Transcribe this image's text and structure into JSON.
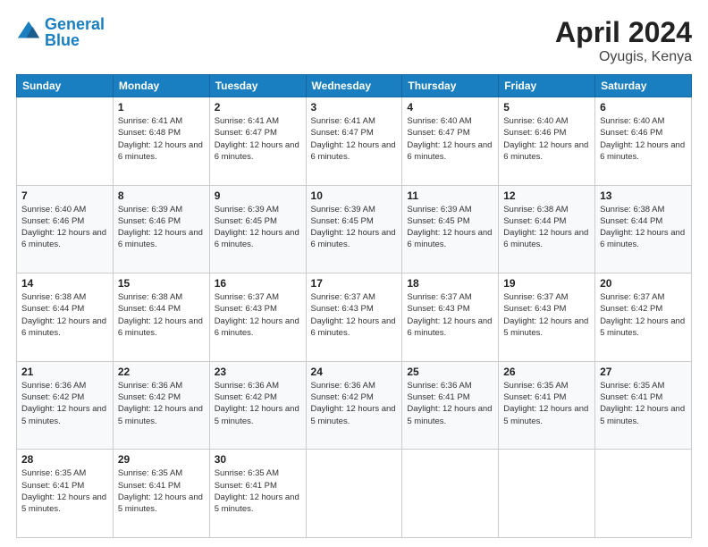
{
  "header": {
    "logo_line1": "General",
    "logo_line2": "Blue",
    "title": "April 2024",
    "subtitle": "Oyugis, Kenya"
  },
  "weekdays": [
    "Sunday",
    "Monday",
    "Tuesday",
    "Wednesday",
    "Thursday",
    "Friday",
    "Saturday"
  ],
  "weeks": [
    [
      {
        "day": "",
        "info": ""
      },
      {
        "day": "1",
        "info": "Sunrise: 6:41 AM\nSunset: 6:48 PM\nDaylight: 12 hours\nand 6 minutes."
      },
      {
        "day": "2",
        "info": "Sunrise: 6:41 AM\nSunset: 6:47 PM\nDaylight: 12 hours\nand 6 minutes."
      },
      {
        "day": "3",
        "info": "Sunrise: 6:41 AM\nSunset: 6:47 PM\nDaylight: 12 hours\nand 6 minutes."
      },
      {
        "day": "4",
        "info": "Sunrise: 6:40 AM\nSunset: 6:47 PM\nDaylight: 12 hours\nand 6 minutes."
      },
      {
        "day": "5",
        "info": "Sunrise: 6:40 AM\nSunset: 6:46 PM\nDaylight: 12 hours\nand 6 minutes."
      },
      {
        "day": "6",
        "info": "Sunrise: 6:40 AM\nSunset: 6:46 PM\nDaylight: 12 hours\nand 6 minutes."
      }
    ],
    [
      {
        "day": "7",
        "info": "Sunrise: 6:40 AM\nSunset: 6:46 PM\nDaylight: 12 hours\nand 6 minutes."
      },
      {
        "day": "8",
        "info": "Sunrise: 6:39 AM\nSunset: 6:46 PM\nDaylight: 12 hours\nand 6 minutes."
      },
      {
        "day": "9",
        "info": "Sunrise: 6:39 AM\nSunset: 6:45 PM\nDaylight: 12 hours\nand 6 minutes."
      },
      {
        "day": "10",
        "info": "Sunrise: 6:39 AM\nSunset: 6:45 PM\nDaylight: 12 hours\nand 6 minutes."
      },
      {
        "day": "11",
        "info": "Sunrise: 6:39 AM\nSunset: 6:45 PM\nDaylight: 12 hours\nand 6 minutes."
      },
      {
        "day": "12",
        "info": "Sunrise: 6:38 AM\nSunset: 6:44 PM\nDaylight: 12 hours\nand 6 minutes."
      },
      {
        "day": "13",
        "info": "Sunrise: 6:38 AM\nSunset: 6:44 PM\nDaylight: 12 hours\nand 6 minutes."
      }
    ],
    [
      {
        "day": "14",
        "info": "Sunrise: 6:38 AM\nSunset: 6:44 PM\nDaylight: 12 hours\nand 6 minutes."
      },
      {
        "day": "15",
        "info": "Sunrise: 6:38 AM\nSunset: 6:44 PM\nDaylight: 12 hours\nand 6 minutes."
      },
      {
        "day": "16",
        "info": "Sunrise: 6:37 AM\nSunset: 6:43 PM\nDaylight: 12 hours\nand 6 minutes."
      },
      {
        "day": "17",
        "info": "Sunrise: 6:37 AM\nSunset: 6:43 PM\nDaylight: 12 hours\nand 6 minutes."
      },
      {
        "day": "18",
        "info": "Sunrise: 6:37 AM\nSunset: 6:43 PM\nDaylight: 12 hours\nand 6 minutes."
      },
      {
        "day": "19",
        "info": "Sunrise: 6:37 AM\nSunset: 6:43 PM\nDaylight: 12 hours\nand 5 minutes."
      },
      {
        "day": "20",
        "info": "Sunrise: 6:37 AM\nSunset: 6:42 PM\nDaylight: 12 hours\nand 5 minutes."
      }
    ],
    [
      {
        "day": "21",
        "info": "Sunrise: 6:36 AM\nSunset: 6:42 PM\nDaylight: 12 hours\nand 5 minutes."
      },
      {
        "day": "22",
        "info": "Sunrise: 6:36 AM\nSunset: 6:42 PM\nDaylight: 12 hours\nand 5 minutes."
      },
      {
        "day": "23",
        "info": "Sunrise: 6:36 AM\nSunset: 6:42 PM\nDaylight: 12 hours\nand 5 minutes."
      },
      {
        "day": "24",
        "info": "Sunrise: 6:36 AM\nSunset: 6:42 PM\nDaylight: 12 hours\nand 5 minutes."
      },
      {
        "day": "25",
        "info": "Sunrise: 6:36 AM\nSunset: 6:41 PM\nDaylight: 12 hours\nand 5 minutes."
      },
      {
        "day": "26",
        "info": "Sunrise: 6:35 AM\nSunset: 6:41 PM\nDaylight: 12 hours\nand 5 minutes."
      },
      {
        "day": "27",
        "info": "Sunrise: 6:35 AM\nSunset: 6:41 PM\nDaylight: 12 hours\nand 5 minutes."
      }
    ],
    [
      {
        "day": "28",
        "info": "Sunrise: 6:35 AM\nSunset: 6:41 PM\nDaylight: 12 hours\nand 5 minutes."
      },
      {
        "day": "29",
        "info": "Sunrise: 6:35 AM\nSunset: 6:41 PM\nDaylight: 12 hours\nand 5 minutes."
      },
      {
        "day": "30",
        "info": "Sunrise: 6:35 AM\nSunset: 6:41 PM\nDaylight: 12 hours\nand 5 minutes."
      },
      {
        "day": "",
        "info": ""
      },
      {
        "day": "",
        "info": ""
      },
      {
        "day": "",
        "info": ""
      },
      {
        "day": "",
        "info": ""
      }
    ]
  ]
}
